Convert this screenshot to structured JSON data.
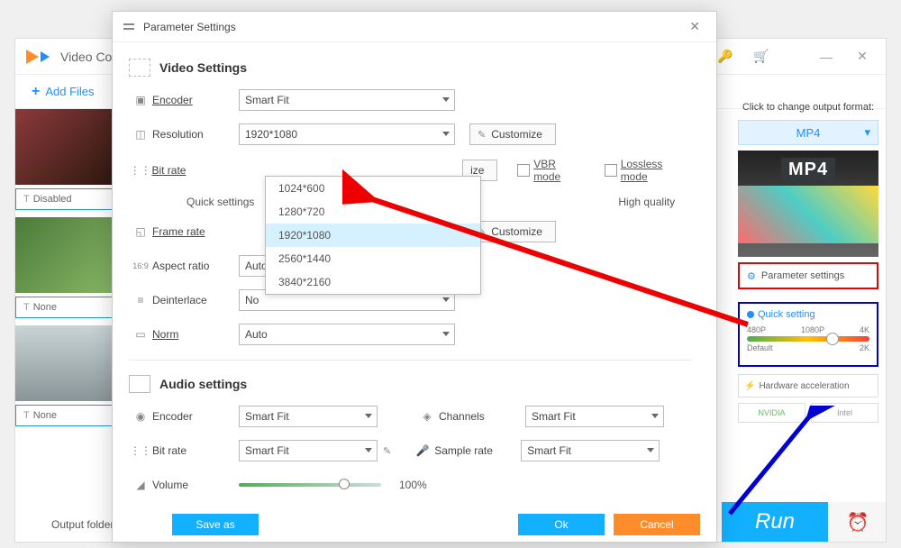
{
  "main": {
    "title": "Video Conv",
    "add_files": "Add Files",
    "thumb_labels": [
      "Disabled",
      "None",
      "None"
    ],
    "output_folder_label": "Output folder:"
  },
  "right": {
    "click_change": "Click to change output format:",
    "format": "MP4",
    "format_badge": "MP4",
    "param_settings": "Parameter settings",
    "quick_setting": "Quick setting",
    "ticks": [
      "480P",
      "1080P",
      "4K"
    ],
    "bottom_ticks": [
      "Default",
      "2K"
    ],
    "hardware_accel": "Hardware acceleration",
    "nvidia": "NVIDIA",
    "intel": "Intel",
    "run": "Run"
  },
  "modal": {
    "title": "Parameter Settings",
    "video_section": "Video Settings",
    "audio_section": "Audio settings",
    "rows": {
      "encoder": "Encoder",
      "encoder_val": "Smart Fit",
      "resolution": "Resolution",
      "resolution_val": "1920*1080",
      "bitrate": "Bit rate",
      "quick_settings": "Quick settings",
      "high_quality": "High quality",
      "framerate": "Frame rate",
      "aspect": "Aspect ratio",
      "aspect_val": "Auto",
      "deinterlace": "Deinterlace",
      "deinterlace_val": "No",
      "norm": "Norm",
      "norm_val": "Auto",
      "a_encoder": "Encoder",
      "a_encoder_val": "Smart Fit",
      "a_bitrate": "Bit rate",
      "a_bitrate_val": "Smart Fit",
      "channels": "Channels",
      "channels_val": "Smart Fit",
      "samplerate": "Sample rate",
      "samplerate_val": "Smart Fit",
      "volume": "Volume",
      "volume_pct": "100%"
    },
    "customize": "Customize",
    "vbr": "VBR mode",
    "lossless": "Lossless mode",
    "save_as": "Save as",
    "ok": "Ok",
    "cancel": "Cancel",
    "size_label": "ize"
  },
  "dropdown": {
    "items": [
      "1024*600",
      "1280*720",
      "1920*1080",
      "2560*1440",
      "3840*2160"
    ],
    "selected_index": 2
  }
}
